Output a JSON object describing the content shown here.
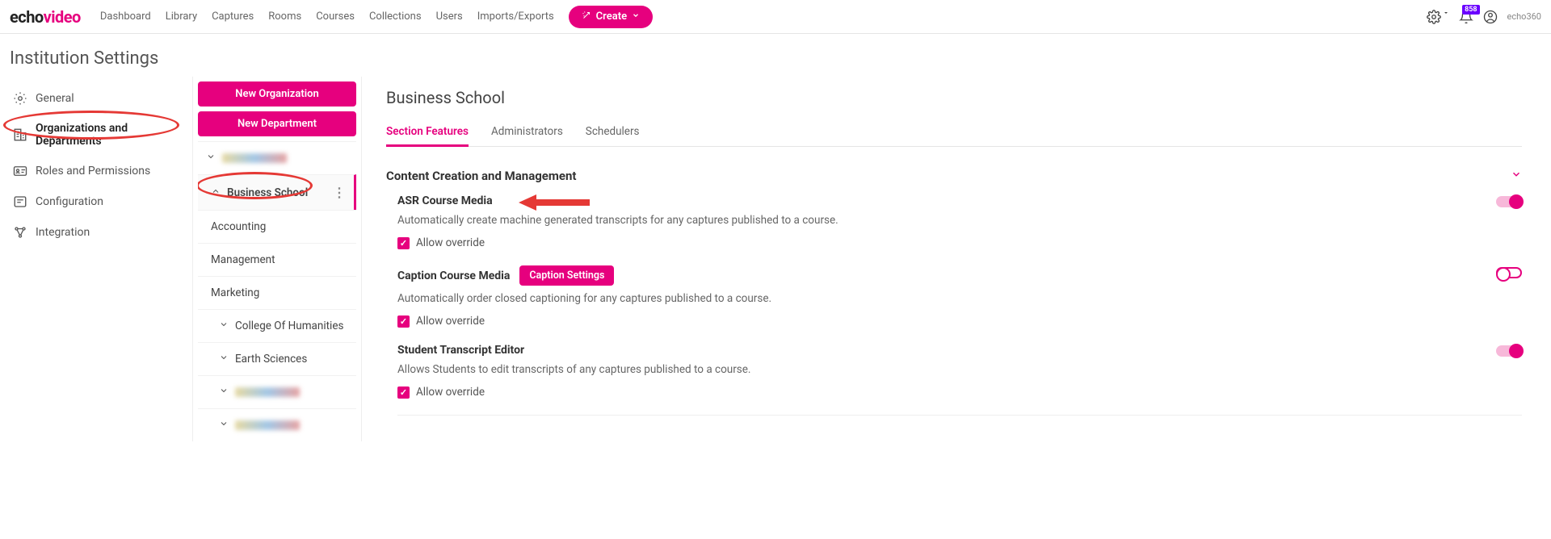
{
  "logo": {
    "part1": "echo",
    "part2": "video"
  },
  "nav": {
    "dashboard": "Dashboard",
    "library": "Library",
    "captures": "Captures",
    "rooms": "Rooms",
    "courses": "Courses",
    "collections": "Collections",
    "users": "Users",
    "imports": "Imports/Exports",
    "create": "Create",
    "badge": "858",
    "tenant": "echo360"
  },
  "page_title": "Institution Settings",
  "sidebar": {
    "general": "General",
    "orgs": "Organizations and Departments",
    "roles": "Roles and Permissions",
    "config": "Configuration",
    "integration": "Integration"
  },
  "tree": {
    "new_org": "New Organization",
    "new_dept": "New Department",
    "business_school": "Business School",
    "accounting": "Accounting",
    "management": "Management",
    "marketing": "Marketing",
    "humanities": "College Of Humanities",
    "earth": "Earth Sciences"
  },
  "panel": {
    "title": "Business School",
    "tabs": {
      "features": "Section Features",
      "admins": "Administrators",
      "sched": "Schedulers"
    },
    "section": "Content Creation and Management",
    "asr": {
      "name": "ASR Course Media",
      "desc": "Automatically create machine generated transcripts for any captures published to a course.",
      "allow": "Allow override"
    },
    "caption": {
      "name": "Caption Course Media",
      "btn": "Caption Settings",
      "desc": "Automatically order closed captioning for any captures published to a course.",
      "allow": "Allow override"
    },
    "student": {
      "name": "Student Transcript Editor",
      "desc": "Allows Students to edit transcripts of any captures published to a course.",
      "allow": "Allow override"
    }
  }
}
